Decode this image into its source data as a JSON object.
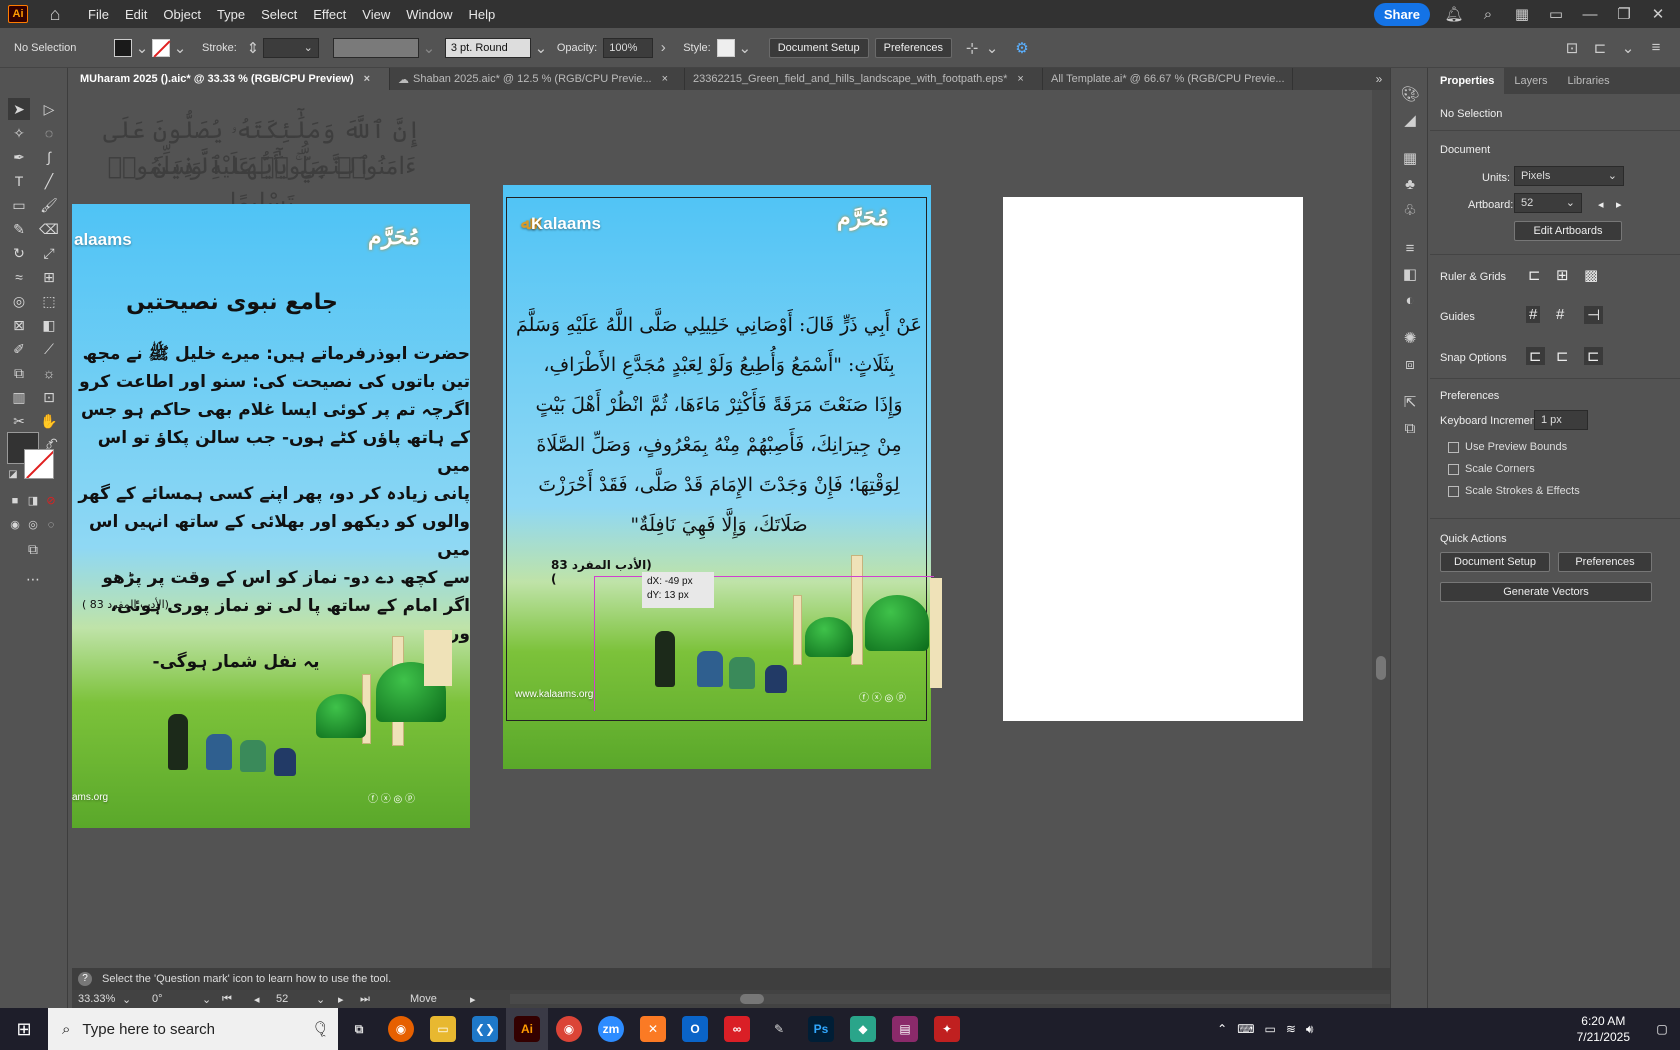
{
  "menubar": {
    "logo": "Ai",
    "items": [
      "File",
      "Edit",
      "Object",
      "Type",
      "Select",
      "Effect",
      "View",
      "Window",
      "Help"
    ],
    "share": "Share"
  },
  "control": {
    "selection": "No Selection",
    "stroke_label": "Stroke:",
    "brush": "3 pt. Round",
    "opacity_label": "Opacity:",
    "opacity": "100%",
    "style_label": "Style:",
    "doc_setup": "Document Setup",
    "preferences": "Preferences"
  },
  "tabs": [
    {
      "label": "MUharam 2025 ().aic* @ 33.33 % (RGB/CPU Preview)",
      "close": "×"
    },
    {
      "label": "Shaban 2025.aic* @ 12.5 % (RGB/CPU Previe...",
      "close": "×"
    },
    {
      "label": "23362215_Green_field_and_hills_landscape_with_footpath.eps*",
      "close": "×"
    },
    {
      "label": "All Template.ai* @ 66.67 % (RGB/CPU Previe...",
      "close": "×"
    }
  ],
  "canvas": {
    "ghost_line1": "إِنَّ ٱللَّهَ وَمَلَٰٓئِكَتَهُۥ يُصَلُّونَ عَلَى ٱلنَّبِيِّ ۚ يَٰٓأَيُّهَا ٱلَّذِينَ",
    "ghost_line2": "ءَامَنُوا۟ صَلُّوا۟ عَلَيْهِ وَسَلِّمُوا۟ تَسْلِيمًا",
    "left_art": {
      "brand": "alaams",
      "month": "مُحَرَّم",
      "heading": "جامع نبوی نصیحتیں",
      "body": [
        "حضرت ابوذرفرماتے ہیں: میرے خلیل ﷺ نے مجھ",
        "تین باتوں کی نصیحت کی: سنو اور اطاعت کرو",
        "اگرچہ تم پر کوئی ایسا غلام بھی حاکم ہو جس",
        "کے ہاتھ پاؤں کٹے ہوں- جب سالن پکاؤ تو اس میں",
        "پانی زیادہ کر دو، پھر اپنے کسی ہمسائے کے گھر",
        "والوں کو دیکھو اور بھلائی کے ساتھ انہیں اس میں",
        "سے کچھ دے دو- نماز کو اس کے وقت پر پڑھو",
        "اگر امام کے ساتھ پا لی تو نماز پوری ہوئی، ورنہ",
        "یہ نفل شمار ہوگی-"
      ],
      "reference": "(الأدب المفرد 83 )",
      "website": "ams.org"
    },
    "center_art": {
      "brand": "Kalaams",
      "month": "مُحَرَّم",
      "body": [
        "عَنْ أَبِي ذَرٍّ قَالَ: أَوْصَانِي خَلِيلِي صَلَّى اللَّهُ عَلَيْهِ وَسَلَّمَ",
        "بِثَلَاثٍ: \"أَسْمَعُ وَأُطِيعُ وَلَوْ لِعَبْدٍ مُجَدَّعِ الأَطْرَافِ،",
        "وَإِذَا صَنَعْتَ مَرَقَةً فَأَكْثِرْ مَاءَهَا، ثُمَّ انْظُرْ أَهْلَ بَيْتٍ",
        "مِنْ جِيرَانِكَ، فَأَصِبْهُمْ مِنْهُ بِمَعْرُوفٍ، وَصَلِّ الصَّلَاةَ",
        "لِوَقْتِهَا؛ فَإِنْ وَجَدْتَ الإِمَامَ قَدْ صَلَّى، فَقَدْ أَحْرَزْتَ",
        "صَلَاتَكَ، وَإِلَّا فَهِيَ نَافِلَةٌ\""
      ],
      "reference": "(الأدب المفرد 83 )",
      "website": "www.kalaams.org",
      "social": "ⓕ ⓧ ◎ ⓟ"
    },
    "tooltip": {
      "dx": "dX: -49 px",
      "dy": "dY: 13 px"
    }
  },
  "panel": {
    "tabs": [
      "Properties",
      "Layers",
      "Libraries"
    ],
    "no_selection": "No Selection",
    "document": "Document",
    "units_label": "Units:",
    "units": "Pixels",
    "artboard_label": "Artboard:",
    "artboard": "52",
    "edit_artboards": "Edit Artboards",
    "rulers": "Ruler & Grids",
    "guides": "Guides",
    "snap": "Snap Options",
    "preferences": "Preferences",
    "kb_label": "Keyboard Increment:",
    "kb_value": "1 px",
    "checks": [
      "Use Preview Bounds",
      "Scale Corners",
      "Scale Strokes & Effects"
    ],
    "quick_actions": "Quick Actions",
    "qa_doc_setup": "Document Setup",
    "qa_prefs": "Preferences",
    "qa_generate": "Generate Vectors"
  },
  "status": {
    "hint": "Select the 'Question mark' icon to learn how to use the tool.",
    "zoom": "33.33%",
    "rotation": "0°",
    "artboard": "52",
    "tool": "Move"
  },
  "taskbar": {
    "search": "Type here to search",
    "time": "6:20 AM",
    "date": "7/21/2025"
  }
}
